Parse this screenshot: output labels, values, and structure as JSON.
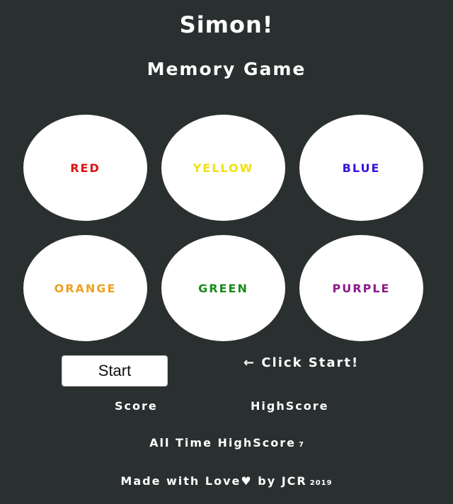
{
  "header": {
    "title": "Simon!",
    "subtitle": "Memory Game"
  },
  "pads": [
    {
      "label": "RED",
      "color": "#e01010"
    },
    {
      "label": "YELLOW",
      "color": "#f0e010"
    },
    {
      "label": "BLUE",
      "color": "#3a10e0"
    },
    {
      "label": "ORANGE",
      "color": "#f0a020"
    },
    {
      "label": "GREEN",
      "color": "#1a8a1a"
    },
    {
      "label": "PURPLE",
      "color": "#8a1a8a"
    }
  ],
  "controls": {
    "start_label": "Start",
    "hint": "← Click Start!"
  },
  "scores": {
    "score_label": "Score",
    "highscore_label": "HighScore",
    "all_time_label": "All Time HighScore",
    "all_time_value": "7"
  },
  "footer": {
    "text": "Made with Love♥ by JCR",
    "year": "2019"
  },
  "colors": {
    "background": "#2a2f30",
    "text": "#ffffff",
    "pad": "#ffffff"
  }
}
